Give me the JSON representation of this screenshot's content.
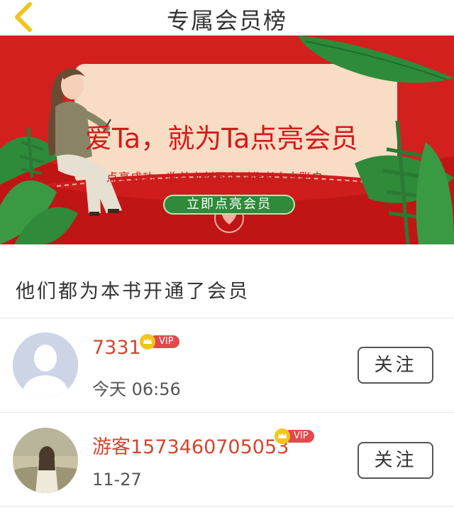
{
  "header": {
    "title": "专属会员榜",
    "back_icon": "chevron-left-icon",
    "back_color": "#f0c419"
  },
  "banner": {
    "headline": "爱Ta，就为Ta点亮会员",
    "subtitle": "点亮成功，收益立刻同步到作者大大账户",
    "cta_label": "立即点亮会员",
    "colors": {
      "background": "#d3201f",
      "card": "#f8dcc4",
      "cta": "#2f8a3a",
      "leaf": "#2e8b3a"
    }
  },
  "section": {
    "title": "他们都为本书开通了会员"
  },
  "members": [
    {
      "name": "7331",
      "vip_label": "VIP",
      "time": "今天 06:56",
      "follow_label": "关注",
      "avatar": "default-avatar"
    },
    {
      "name": "游客1573460705053",
      "vip_label": "VIP",
      "time": "11-27",
      "follow_label": "关注",
      "avatar": "photo-avatar"
    }
  ]
}
